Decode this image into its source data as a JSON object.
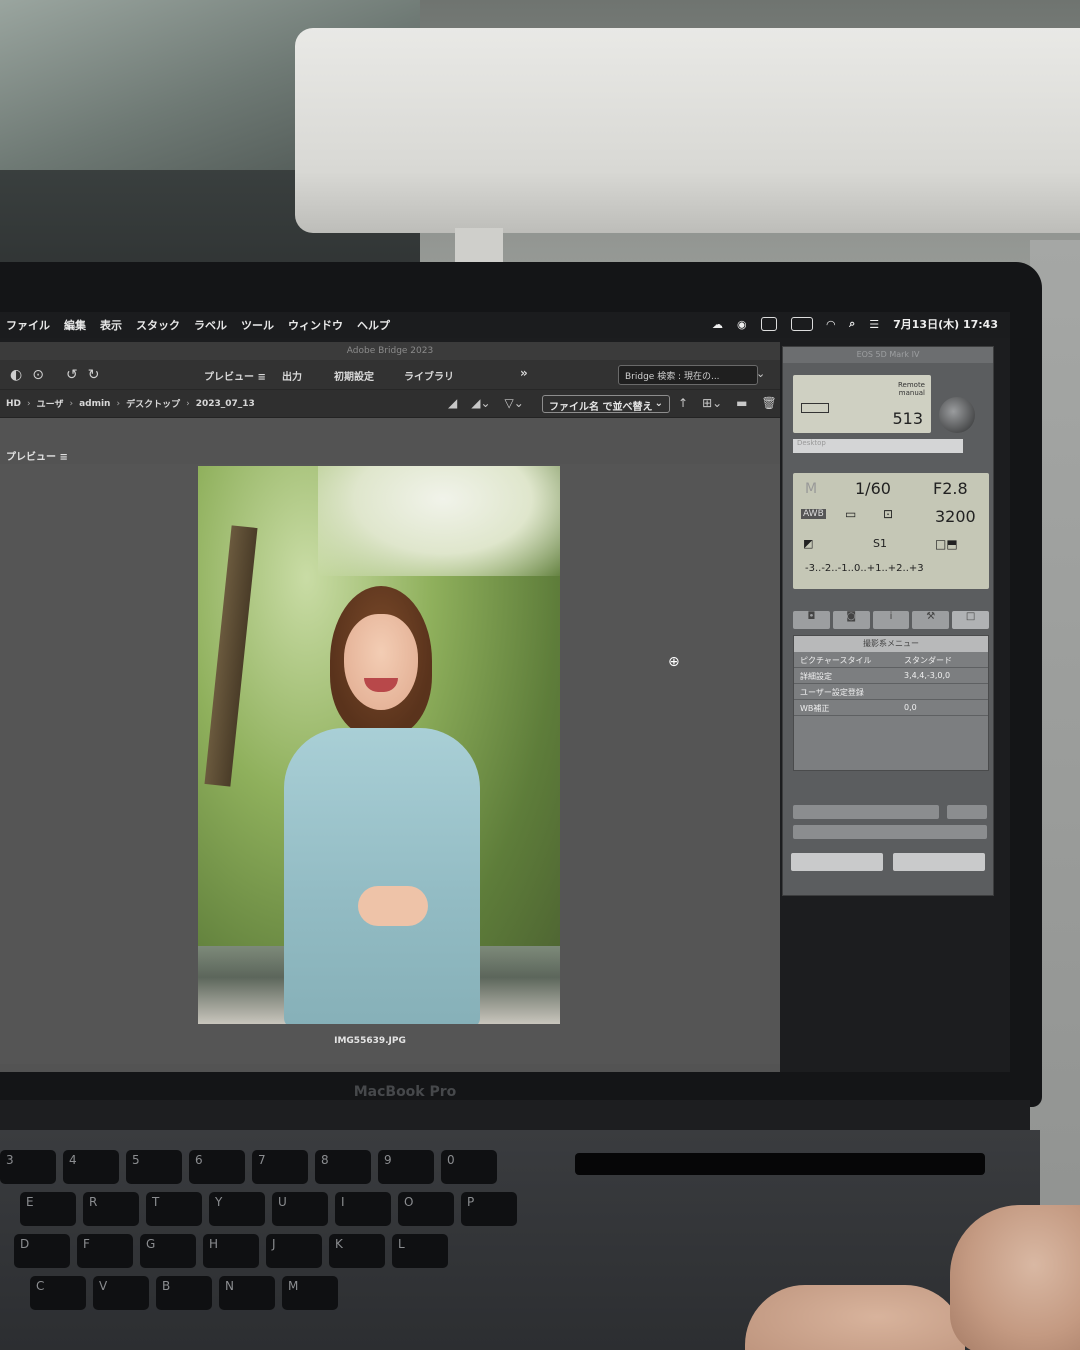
{
  "menubar": {
    "items": [
      "ファイル",
      "編集",
      "表示",
      "スタック",
      "ラベル",
      "ツール",
      "ウィンドウ",
      "ヘルプ"
    ],
    "datetime": "7月13日(木) 17:43"
  },
  "bridge": {
    "title": "Adobe Bridge 2023",
    "workspaces": [
      "プレビュー ≡",
      "出力",
      "初期設定",
      "ライブラリ"
    ],
    "more": "»",
    "search_placeholder": "Bridge 検索 : 現在の...",
    "breadcrumb": [
      "HD",
      "ユーザ",
      "admin",
      "デスクトップ",
      "2023_07_13"
    ],
    "sort_label": "ファイル名 で並べ替え",
    "panel_tab": "プレビュー ≡",
    "filename": "IMG55639.JPG"
  },
  "eos": {
    "title": "EOS 5D Mark IV",
    "remote_line1": "Remote",
    "remote_line2": "manual",
    "shots_remaining": "513",
    "save_dest": "Desktop",
    "mode": "M",
    "shutter": "1/60",
    "aperture": "F2.8",
    "wb": "AWB",
    "iso": "3200",
    "quality": "S1",
    "exposure_scale": "-3..-2..-1..0..+1..+2..+3",
    "menu_title": "撮影系メニュー",
    "menu_rows": [
      {
        "label": "ピクチャースタイル",
        "value": "スタンダード"
      },
      {
        "label": "詳細設定",
        "value": "3,4,4,-3,0,0"
      },
      {
        "label": "ユーザー設定登録",
        "value": ""
      },
      {
        "label": "WB補正",
        "value": "0,0"
      }
    ]
  },
  "laptop": {
    "brand": "MacBook Pro"
  },
  "keyboard": {
    "row1": [
      "3",
      "4",
      "5",
      "6",
      "7",
      "8",
      "9",
      "0"
    ],
    "row2": [
      "E",
      "R",
      "T",
      "Y",
      "U",
      "I",
      "O",
      "P"
    ],
    "row3": [
      "D",
      "F",
      "G",
      "H",
      "J",
      "K",
      "L"
    ],
    "row4": [
      "C",
      "V",
      "B",
      "N",
      "M"
    ]
  }
}
